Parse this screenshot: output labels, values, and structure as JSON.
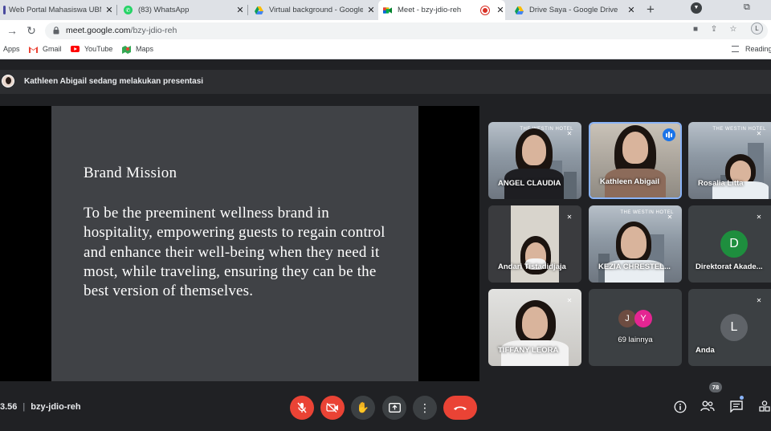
{
  "browser": {
    "tabs": [
      {
        "title": "Web Portal Mahasiswa UBM",
        "active": false
      },
      {
        "title": "(83) WhatsApp",
        "active": false
      },
      {
        "title": "Virtual background - Google",
        "active": false
      },
      {
        "title": "Meet - bzy-jdio-reh",
        "active": true
      },
      {
        "title": "Drive Saya - Google Drive",
        "active": false
      }
    ],
    "url_host": "meet.google.com",
    "url_path": "/bzy-jdio-reh",
    "profile_initial": "L",
    "bookmarks": [
      "Apps",
      "Gmail",
      "YouTube",
      "Maps"
    ],
    "reading_list": "Reading"
  },
  "meet": {
    "banner_text": "Kathleen Abigail sedang melakukan presentasi",
    "slide": {
      "title": "Brand Mission",
      "body": "To be the preeminent wellness brand in hospitality, empowering guests to regain control and enhance their well-being when they need it most, while traveling, ensuring they can be the best version of themselves."
    },
    "participants": [
      {
        "name": "ANGEL CLAUDIA"
      },
      {
        "name": "Kathleen Abigail"
      },
      {
        "name": "Rosalia Litta"
      },
      {
        "name": "Andari Tistadidjaja"
      },
      {
        "name": "KEZIA CHRESTEL..."
      },
      {
        "name": "Direktorat Akade...",
        "initial": "D"
      },
      {
        "name": "TIFFANY LEORA"
      },
      {
        "name": "69 lainnya",
        "initials": [
          "J",
          "Y"
        ]
      },
      {
        "name": "Anda",
        "initial": "L"
      }
    ],
    "hotel_watermark": "THE WESTIN HOTEL",
    "clock": "3.56",
    "meeting_code": "bzy-jdio-reh",
    "participant_count": "78",
    "colors": {
      "end_call": "#ea4335",
      "active_speaker": "#8ab4f8",
      "avatar_d": "#1e8e3e",
      "avatar_j": "#6d4c41",
      "avatar_y": "#e52592",
      "avatar_l": "#5f6368"
    }
  }
}
